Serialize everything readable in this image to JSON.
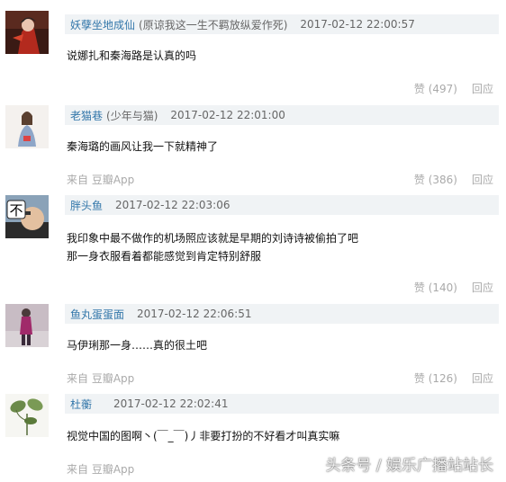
{
  "comments": [
    {
      "author": "妖孽坐地成仙",
      "signature": "(原谅我这一生不羁放纵爱作死)",
      "time": "2017-02-12 22:00:57",
      "lines": [
        "说娜扎和秦海路是认真的吗"
      ],
      "source": "",
      "likes": "赞 (497)",
      "reply": "回应",
      "avatar_icon": "red-costume-avatar"
    },
    {
      "author": "老猫巷",
      "signature": "(少年与猫)",
      "time": "2017-02-12 22:01:00",
      "lines": [
        "秦海璐的画风让我一下就精神了"
      ],
      "source": "来自 豆瓣App",
      "likes": "赞 (386)",
      "reply": "回应",
      "avatar_icon": "girl-figure-avatar"
    },
    {
      "author": "胖头鱼",
      "signature": "",
      "time": "2017-02-12 22:03:06",
      "lines": [
        "我印象中最不做作的机场照应该就是早期的刘诗诗被偷拍了吧",
        "那一身衣服看着都能感觉到肯定特别舒服"
      ],
      "source": "",
      "likes": "赞 (140)",
      "reply": "回应",
      "avatar_icon": "meme-face-avatar"
    },
    {
      "author": "鱼丸蛋蛋面",
      "signature": "",
      "time": "2017-02-12 22:06:51",
      "lines": [
        "马伊琍那一身……真的很土吧"
      ],
      "source": "来自 豆瓣App",
      "likes": "赞 (126)",
      "reply": "回应",
      "avatar_icon": "standing-woman-avatar"
    },
    {
      "author": "杜蘅",
      "signature": "",
      "time": "2017-02-12 22:02:41",
      "lines": [
        "视觉中国的图啊丶(￣_￣)丿非要打扮的不好看才叫真实嘛"
      ],
      "source": "来自 豆瓣App",
      "likes": "",
      "reply": "",
      "avatar_icon": "plant-sketch-avatar"
    }
  ],
  "watermark": "头条号 / 娱乐广播站站长"
}
